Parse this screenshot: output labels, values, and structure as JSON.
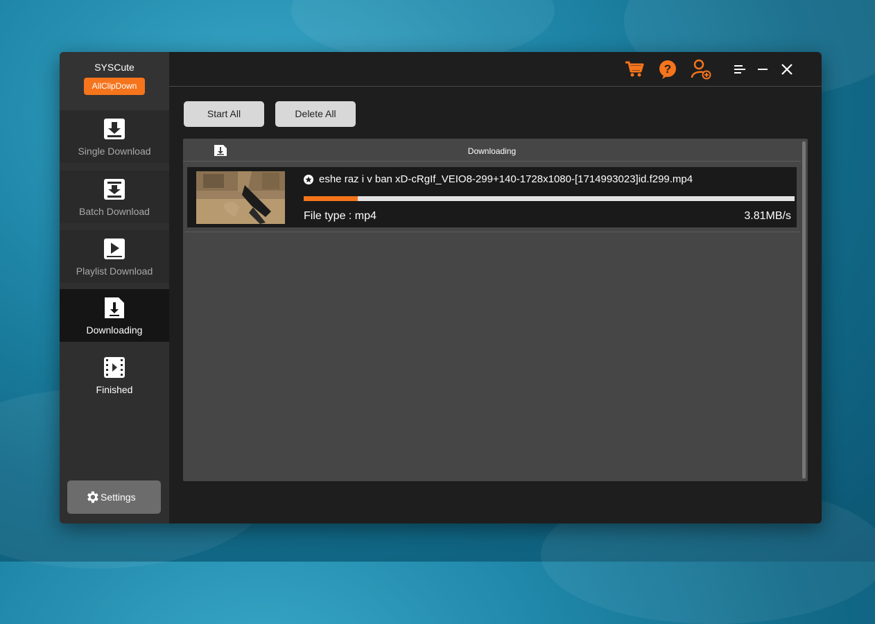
{
  "app": {
    "name": "SYSCute",
    "badge": "AllClipDown"
  },
  "colors": {
    "accent": "#f5741c",
    "window_bg": "#1e1e1e",
    "sidebar_bg": "#2f2f2f",
    "panel_bg": "#464646"
  },
  "sidebar": {
    "items": [
      {
        "label": "Single Download",
        "icon": "download-tray-icon"
      },
      {
        "label": "Batch Download",
        "icon": "batch-download-icon"
      },
      {
        "label": "Playlist Download",
        "icon": "playlist-play-icon"
      },
      {
        "label": "Downloading",
        "icon": "file-download-icon",
        "active": true
      },
      {
        "label": "Finished",
        "icon": "film-icon"
      }
    ],
    "settings_label": "Settings"
  },
  "toolbar": {
    "icons": [
      "cart-icon",
      "help-icon",
      "user-add-icon",
      "menu-icon",
      "minimize-icon",
      "close-icon"
    ],
    "start_all": "Start All",
    "delete_all": "Delete All"
  },
  "downloads": {
    "header_title": "Downloading",
    "items": [
      {
        "filename": "eshe raz i v ban xD-cRgIf_VEIO8-299+140-1728x1080-[1714993023]id.f299.mp4",
        "progress": 0.11,
        "file_type": "File type : mp4",
        "speed": "3.81MB/s"
      }
    ]
  }
}
